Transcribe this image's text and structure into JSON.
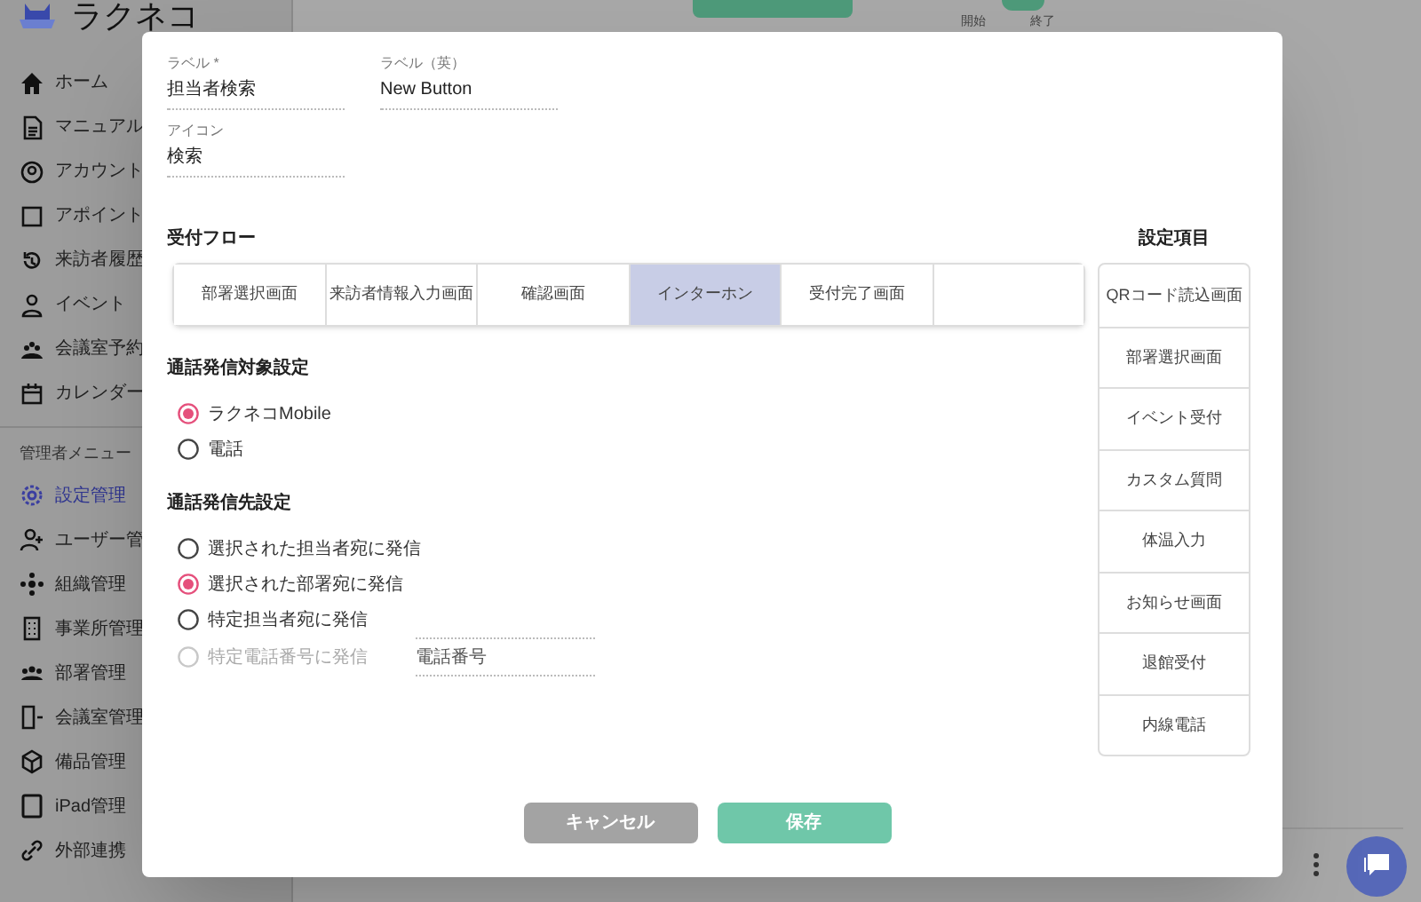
{
  "app": {
    "logo": "ラクネコ"
  },
  "sidebar": {
    "items": [
      {
        "label": "ホーム",
        "selected": false
      },
      {
        "label": "マニュアル",
        "selected": false
      },
      {
        "label": "アカウント",
        "selected": false
      },
      {
        "label": "アポイント",
        "selected": false
      },
      {
        "label": "来訪者履歴",
        "selected": false
      },
      {
        "label": "イベント",
        "selected": false
      },
      {
        "label": "会議室予約",
        "selected": false
      },
      {
        "label": "カレンダー",
        "selected": false
      }
    ],
    "section_label": "管理者メニュー",
    "admin_items": [
      {
        "label": "設定管理",
        "selected": true
      },
      {
        "label": "ユーザー管",
        "selected": false
      },
      {
        "label": "組織管理",
        "selected": false
      },
      {
        "label": "事業所管理",
        "selected": false
      },
      {
        "label": "部署管理",
        "selected": false
      },
      {
        "label": "会議室管理",
        "selected": false
      },
      {
        "label": "備品管理",
        "selected": false
      },
      {
        "label": "iPad管理",
        "selected": false
      },
      {
        "label": "外部連携",
        "selected": false
      }
    ]
  },
  "background": {
    "toggle_on": true,
    "start_label": "開始",
    "end_label": "終了"
  },
  "modal": {
    "fields": [
      {
        "label": "ラベル *",
        "value": "担当者検索"
      },
      {
        "label": "ラベル（英）",
        "value": "New Button"
      },
      {
        "label": "アイコン",
        "value": "検索"
      }
    ],
    "flow": {
      "title": "受付フロー",
      "steps": [
        {
          "label": "部署選択画面",
          "selected": false
        },
        {
          "label": "来訪者情報入力画面",
          "selected": false
        },
        {
          "label": "確認画面",
          "selected": false
        },
        {
          "label": "インターホン",
          "selected": true
        },
        {
          "label": "受付完了画面",
          "selected": false
        },
        {
          "selected": false
        }
      ]
    },
    "settings": {
      "title": "設定項目",
      "items": [
        "QRコード読込画面",
        "部署選択画面",
        "イベント受付",
        "カスタム質問",
        "体温入力",
        "お知らせ画面",
        "退館受付",
        "内線電話"
      ]
    },
    "call_target": {
      "title": "通話発信対象設定",
      "options": [
        {
          "label": "ラクネコMobile",
          "selected": true
        },
        {
          "label": "電話",
          "selected": false
        }
      ]
    },
    "call_destination": {
      "title": "通話発信先設定",
      "options": [
        {
          "label": "選択された担当者宛に発信",
          "selected": false,
          "disabled": false
        },
        {
          "label": "選択された部署宛に発信",
          "selected": true,
          "disabled": false
        },
        {
          "label": "特定担当者宛に発信",
          "selected": false,
          "disabled": false
        },
        {
          "label": "特定電話番号に発信",
          "selected": false,
          "disabled": true
        }
      ],
      "phone_field": {
        "placeholder": "電話番号"
      }
    },
    "buttons": [
      {
        "label": "キャンセル",
        "kind": "cancel"
      },
      {
        "label": "保存",
        "kind": "save"
      }
    ]
  }
}
